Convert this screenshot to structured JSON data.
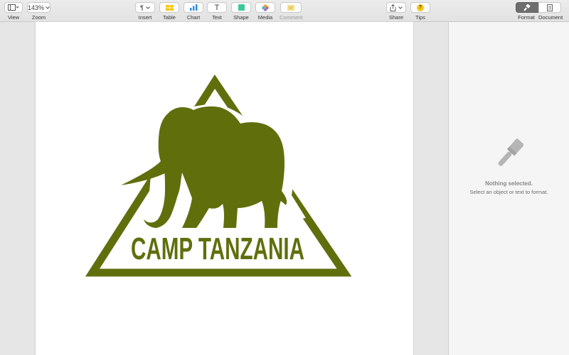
{
  "toolbar": {
    "view": {
      "label": "View",
      "icon": "sidebar-view-icon"
    },
    "zoom": {
      "label": "Zoom",
      "value": "143%"
    },
    "insert": {
      "label": "Insert",
      "glyph": "¶"
    },
    "table": {
      "label": "Table"
    },
    "chart": {
      "label": "Chart"
    },
    "text": {
      "label": "Text",
      "glyph": "T"
    },
    "shape": {
      "label": "Shape"
    },
    "media": {
      "label": "Media"
    },
    "comment": {
      "label": "Comment"
    },
    "share": {
      "label": "Share"
    },
    "tips": {
      "label": "Tips",
      "glyph": "?"
    },
    "format": {
      "label": "Format"
    },
    "document": {
      "label": "Document"
    }
  },
  "document": {
    "logo_text": "CAMP TANZANIA",
    "logo_color": "#606f0c"
  },
  "inspector": {
    "title": "Nothing selected.",
    "subtitle": "Select an object or text to format."
  },
  "colors": {
    "table_icon": "#f5c518",
    "chart_icon": "#2f8ff0",
    "shape_icon": "#3cc99a",
    "tips_icon": "#f5c518"
  }
}
